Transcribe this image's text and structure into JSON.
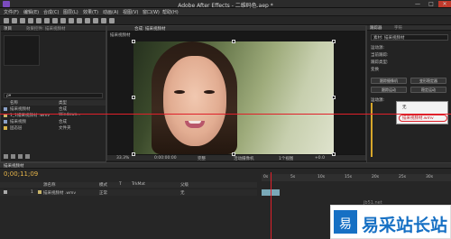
{
  "window": {
    "title": "Adobe After Effects - 二维码色.aep *",
    "min": "—",
    "max": "□",
    "close": "✕"
  },
  "menu": [
    "文件(F)",
    "编辑(E)",
    "合成(C)",
    "图层(L)",
    "效果(T)",
    "动画(A)",
    "视图(V)",
    "窗口(W)",
    "帮助(H)"
  ],
  "project": {
    "tab": "项目",
    "tab2": "效果控件: 描采视频材",
    "search_placeholder": "ρ▾",
    "columns": [
      "名称",
      "类型"
    ],
    "items": [
      {
        "name": "描采视频材",
        "type": "合成"
      },
      {
        "name": "1_1描采视频材 .wmv",
        "type": "Windows..."
      },
      {
        "name": "描采视频",
        "type": "合成"
      },
      {
        "name": "固态层",
        "type": "文件夹"
      }
    ]
  },
  "comp": {
    "tab": "合成: 描采视频材",
    "label": "描采视频材",
    "footer": [
      "33.3%",
      "0:00:00:00",
      "完整",
      "活动摄像机",
      "1个视图",
      "+0.0"
    ]
  },
  "right_panel": {
    "tabs": [
      "跟踪器",
      "字符"
    ],
    "track_source": "素材: 描采视频材",
    "rows": [
      "运动源:",
      "当前跟踪:",
      "跟踪类型:",
      "变换"
    ],
    "buttons": [
      "跟踪摄像机",
      "变形稳定器",
      "跟踪运动",
      "稳定运动"
    ],
    "field_label": "运动源:",
    "field_value": "无"
  },
  "popup": {
    "options": [
      "无",
      "描采视频材.wmv"
    ]
  },
  "timeline": {
    "tab": "描采视频材",
    "timecode": "0;00;11;09",
    "columns": [
      "源名称",
      "模式",
      "T",
      "TrkMat",
      "父级"
    ],
    "layer_number": "1",
    "layer_name": "描采视频材 .wmv",
    "layer_mode": "正常",
    "layer_parent": "无",
    "ruler_labels": [
      "0s",
      "5s",
      "10s",
      "15s",
      "20s",
      "25s",
      "30s"
    ]
  },
  "watermark": {
    "logo_text": "易",
    "text": "易采站长站",
    "url": "jb51.net"
  }
}
